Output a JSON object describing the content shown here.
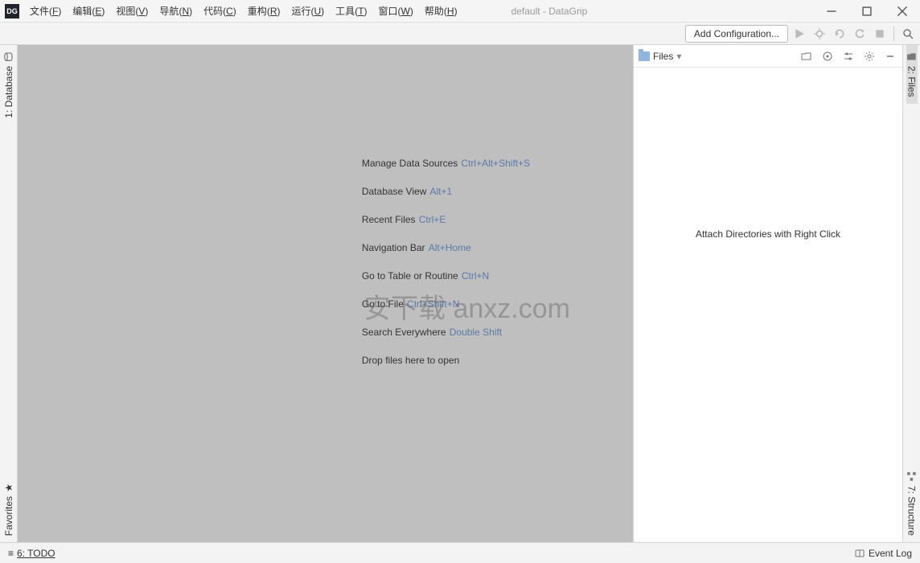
{
  "app": {
    "icon_text": "DG",
    "title": "default - DataGrip"
  },
  "menubar": [
    {
      "label": "文件",
      "key": "F"
    },
    {
      "label": "编辑",
      "key": "E"
    },
    {
      "label": "视图",
      "key": "V"
    },
    {
      "label": "导航",
      "key": "N"
    },
    {
      "label": "代码",
      "key": "C"
    },
    {
      "label": "重构",
      "key": "R"
    },
    {
      "label": "运行",
      "key": "U"
    },
    {
      "label": "工具",
      "key": "T"
    },
    {
      "label": "窗口",
      "key": "W"
    },
    {
      "label": "帮助",
      "key": "H"
    }
  ],
  "toolbar": {
    "add_config": "Add Configuration..."
  },
  "left_tabs": {
    "database": "1: Database",
    "favorites": "Favorites"
  },
  "right_tabs": {
    "files": "2: Files",
    "structure": "7: Structure"
  },
  "welcome": [
    {
      "text": "Manage Data Sources",
      "shortcut": "Ctrl+Alt+Shift+S"
    },
    {
      "text": "Database View",
      "shortcut": "Alt+1"
    },
    {
      "text": "Recent Files",
      "shortcut": "Ctrl+E"
    },
    {
      "text": "Navigation Bar",
      "shortcut": "Alt+Home"
    },
    {
      "text": "Go to Table or Routine",
      "shortcut": "Ctrl+N"
    },
    {
      "text": "Go to File",
      "shortcut": "Ctrl+Shift+N"
    },
    {
      "text": "Search Everywhere",
      "shortcut": "Double Shift"
    },
    {
      "text": "Drop files here to open",
      "shortcut": ""
    }
  ],
  "watermark": "安下载 anxz.com",
  "files_panel": {
    "title": "Files",
    "empty": "Attach Directories with Right Click"
  },
  "statusbar": {
    "todo": "6: TODO",
    "eventlog": "Event Log"
  }
}
